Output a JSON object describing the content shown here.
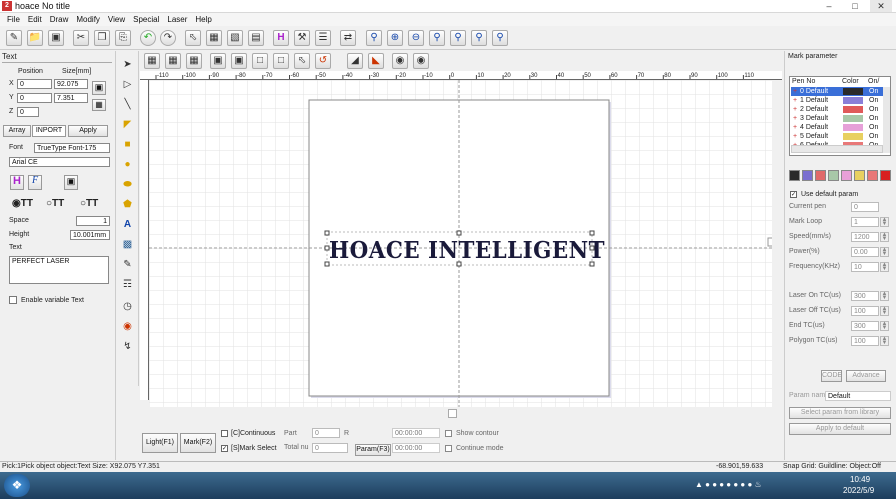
{
  "window": {
    "title": "hoace No title",
    "logo": "2"
  },
  "menu": [
    "File",
    "Edit",
    "Draw",
    "Modify",
    "View",
    "Special",
    "Laser",
    "Help"
  ],
  "left_panel": {
    "title": "Text",
    "position_label": "Position",
    "size_label": "Size[mm]",
    "x_label": "X",
    "y_label": "Y",
    "z_label": "Z",
    "x_value": "0",
    "y_value": "0",
    "z_value": "0",
    "width_value": "92.075",
    "height_value": "7.351",
    "tabs": [
      "Array",
      "INPORT"
    ],
    "apply_label": "Apply",
    "font_label": "Font",
    "font_type": "TrueType Font-175",
    "font_name": "Arial CE",
    "space_label": "Space",
    "space_value": "1",
    "height_label": "Height",
    "height_field": "10.001mm",
    "text_label": "Text",
    "text_value": "PERFECT LASER",
    "variable_label": "Enable variable Text"
  },
  "canvas": {
    "text": "HOACE INTELLIGENT",
    "ruler_labels": [
      "-110",
      "-100",
      "-90",
      "-80",
      "-70",
      "-60",
      "-50",
      "-40",
      "-30",
      "-20",
      "-10",
      "0",
      "10",
      "20",
      "30",
      "40",
      "50",
      "60",
      "70",
      "80",
      "90",
      "100",
      "110"
    ]
  },
  "right_panel": {
    "title": "Mark parameter",
    "pen_headers": [
      "Pen No",
      "Color",
      "On/"
    ],
    "pens": [
      {
        "name": "0 Default",
        "color": "#2a2a2a",
        "state": "On"
      },
      {
        "name": "1 Default",
        "color": "#8a7fd8",
        "state": "On"
      },
      {
        "name": "2 Default",
        "color": "#e05a5a",
        "state": "On"
      },
      {
        "name": "3 Default",
        "color": "#a8c8a8",
        "state": "On"
      },
      {
        "name": "4 Default",
        "color": "#e6a0d8",
        "state": "On"
      },
      {
        "name": "5 Default",
        "color": "#e8d060",
        "state": "On"
      },
      {
        "name": "6 Default",
        "color": "#e87878",
        "state": "On"
      }
    ],
    "swatches": [
      "#2a2a2a",
      "#7a6fd0",
      "#e06a6a",
      "#a8c8a8",
      "#e8a0d8",
      "#e8d060",
      "#e87878",
      "#d82020"
    ],
    "use_default_label": "Use default param",
    "params": [
      {
        "label": "Current pen",
        "value": "0"
      },
      {
        "label": "Mark Loop",
        "value": "1"
      },
      {
        "label": "Speed(mm/s)",
        "value": "1200"
      },
      {
        "label": "Power(%)",
        "value": "0.00"
      },
      {
        "label": "Frequency(KHz)",
        "value": "10"
      },
      {
        "label": "Laser On TC(us)",
        "value": "300"
      },
      {
        "label": "Laser Off TC(us)",
        "value": "100"
      },
      {
        "label": "End TC(us)",
        "value": "300"
      },
      {
        "label": "Polygon TC(us)",
        "value": "100"
      }
    ],
    "code_label": "CODE",
    "advance_label": "Advance",
    "param_name_label": "Param name",
    "param_name_value": "Default",
    "select_library_label": "Select param from library",
    "apply_default_label": "Apply to default"
  },
  "bottom": {
    "light_label": "Light(F1)",
    "mark_label": "Mark(F2)",
    "continuous_label": "[C]Continuous",
    "mark_select_label": "[S]Mark Select",
    "part_label": "Part",
    "part_value": "0",
    "r_label": "R",
    "total_label": "Total nu",
    "total_value": "0",
    "param_label": "Param(F3)",
    "time1": "00:00:00",
    "time2": "00:00:00",
    "show_contour_label": "Show contour",
    "continue_mode_label": "Continue mode"
  },
  "status": {
    "left": "Pick:1Pick object object:Text Size: X92.075 Y7.351",
    "coords": "-68.901,59.633",
    "right": "Snap Grid: Guildline: Object:Off"
  },
  "taskbar": {
    "time": "10:49",
    "date": "2022/5/9"
  }
}
